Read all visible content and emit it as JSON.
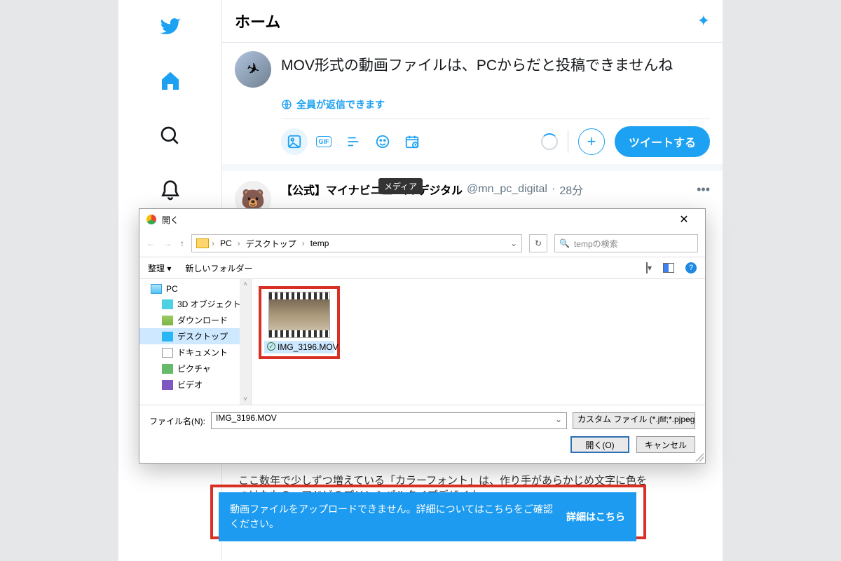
{
  "twitter": {
    "header_title": "ホーム",
    "compose_text": "MOV形式の動画ファイルは、PCからだと投稿できませんね",
    "reply_setting": "全員が返信できます",
    "gif_label": "GIF",
    "tweet_button": "ツイートする",
    "media_tooltip": "メディア",
    "feed": {
      "name": "【公式】マイナビニュース デジタル",
      "handle": "@mn_pc_digital",
      "time": "28分",
      "more": "•••"
    },
    "filler_text": "ここ数年で少しずつ増えている「カラーフォント」は、作り手があらかじめ文字に色をつけたもの。アドビのプリンシパルタイプデザイナ"
  },
  "dialog": {
    "title": "開く",
    "breadcrumbs": [
      "PC",
      "デスクトップ",
      "temp"
    ],
    "search_placeholder": "tempの検索",
    "toolbar": {
      "organize": "整理 ▾",
      "new_folder": "新しいフォルダー"
    },
    "tree": {
      "pc": "PC",
      "objects3d": "3D オブジェクト",
      "downloads": "ダウンロード",
      "desktop": "デスクトップ",
      "documents": "ドキュメント",
      "pictures": "ピクチャ",
      "videos": "ビデオ"
    },
    "file": {
      "name": "IMG_3196.MOV"
    },
    "filename_label": "ファイル名(N):",
    "filename_value": "IMG_3196.MOV",
    "filter_label": "カスタム ファイル (*.jfif;*.pjpeg;*.jp",
    "open_button": "開く(O)",
    "cancel_button": "キャンセル"
  },
  "toast": {
    "message": "動画ファイルをアップロードできません。詳細についてはこちらをご確認ください。",
    "link": "詳細はこちら"
  }
}
